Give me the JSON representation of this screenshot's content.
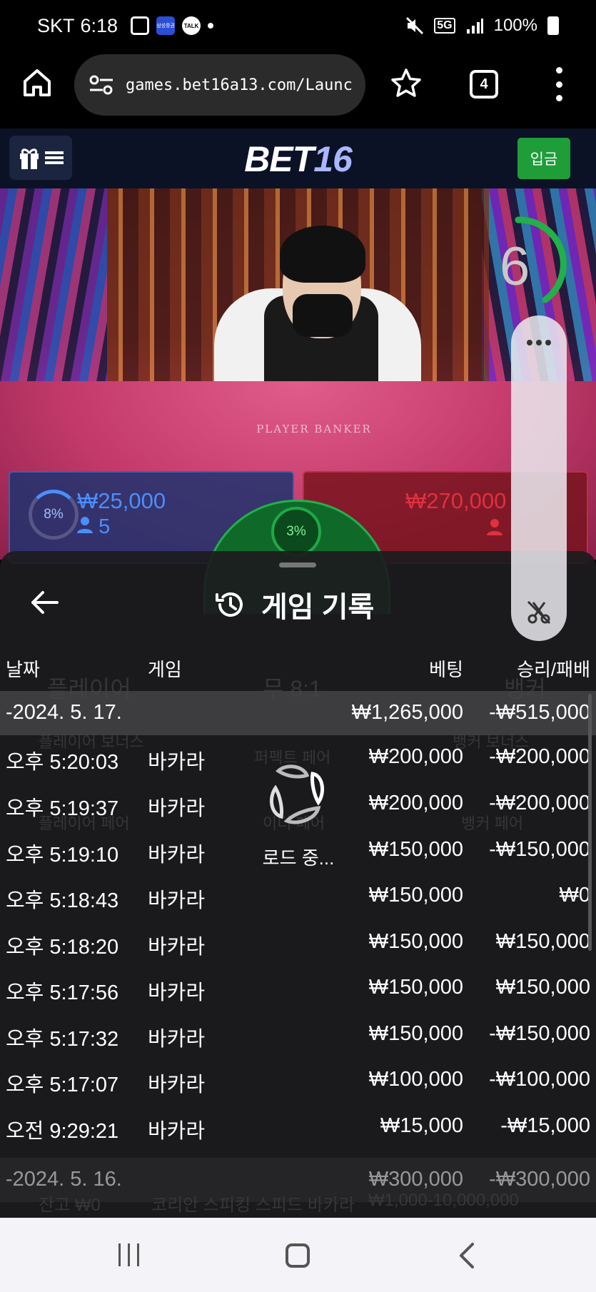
{
  "status_bar": {
    "carrier": "SKT",
    "time": "6:18",
    "samsung_label": "삼성증권",
    "talk_label": "TALK",
    "network": "5G",
    "battery": "100%"
  },
  "browser": {
    "url": "games.bet16a13.com/Launc",
    "tab_count": "4"
  },
  "site": {
    "logo_main": "BET",
    "logo_num": "16",
    "deposit_label": "입금"
  },
  "video": {
    "timer": "6",
    "table_text": "PLAYER     BANKER",
    "player_pct": "8%",
    "player_amount": "₩25,000",
    "player_count": "5",
    "tie_pct": "3%",
    "banker_amount": "₩270,000"
  },
  "sheet": {
    "title": "게임 기록",
    "headers": {
      "date": "날짜",
      "game": "게임",
      "bet": "베팅",
      "result": "승리/패배"
    },
    "day1": {
      "date": "-2024. 5. 17.",
      "bet": "₩1,265,000",
      "result": "-₩515,000"
    },
    "rows": [
      {
        "time": "오후 5:20:03",
        "game": "바카라",
        "bet": "₩200,000",
        "result": "-₩200,000"
      },
      {
        "time": "오후 5:19:37",
        "game": "바카라",
        "bet": "₩200,000",
        "result": "-₩200,000"
      },
      {
        "time": "오후 5:19:10",
        "game": "바카라",
        "bet": "₩150,000",
        "result": "-₩150,000"
      },
      {
        "time": "오후 5:18:43",
        "game": "바카라",
        "bet": "₩150,000",
        "result": "₩0"
      },
      {
        "time": "오후 5:18:20",
        "game": "바카라",
        "bet": "₩150,000",
        "result": "₩150,000"
      },
      {
        "time": "오후 5:17:56",
        "game": "바카라",
        "bet": "₩150,000",
        "result": "₩150,000"
      },
      {
        "time": "오후 5:17:32",
        "game": "바카라",
        "bet": "₩150,000",
        "result": "-₩150,000"
      },
      {
        "time": "오후 5:17:07",
        "game": "바카라",
        "bet": "₩100,000",
        "result": "-₩100,000"
      },
      {
        "time": "오전 9:29:21",
        "game": "바카라",
        "bet": "₩15,000",
        "result": "-₩15,000"
      }
    ],
    "day2": {
      "date": "-2024. 5. 16.",
      "bet": "₩300,000",
      "result": "-₩300,000"
    },
    "ghost": {
      "player": "플레이어",
      "tie": "무 8:1",
      "banker": "뱅커",
      "player_bonus": "플레이어 보너스",
      "perfect_pair": "퍼펙트 페어",
      "banker_bonus": "뱅커 보너스",
      "player_pair": "플레이어 페어",
      "either_pair": "이더 페어",
      "banker_pair": "뱅커 페어",
      "balance": "잔고 ₩0",
      "table_name": "코리안 스피킹 스피드 바카라",
      "limits": "₩1,000-10,000,000"
    },
    "loading": "로드 중..."
  },
  "colors": {
    "deposit_green": "#1f9d38",
    "player_blue": "#4a8fff",
    "banker_red": "#e0313e",
    "header_navy": "#0b1226"
  }
}
